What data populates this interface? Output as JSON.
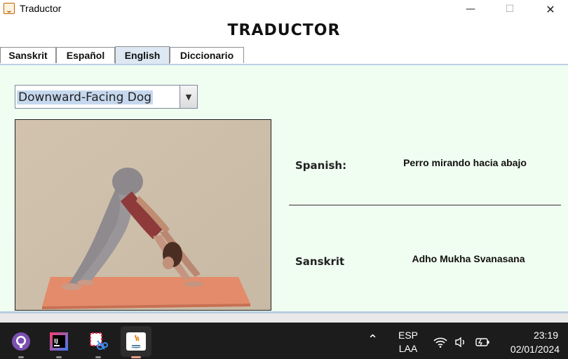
{
  "window": {
    "title": "Traductor",
    "minimize_glyph": "—",
    "maximize_glyph": "☐",
    "close_glyph": "✕"
  },
  "app": {
    "heading": "TRADUCTOR"
  },
  "tabs": [
    {
      "label": "Sanskrit",
      "active": false
    },
    {
      "label": "Español",
      "active": false
    },
    {
      "label": "English",
      "active": true
    },
    {
      "label": "Diccionario",
      "active": false
    }
  ],
  "pose_select": {
    "selected": "Downward-Facing Dog"
  },
  "translations": {
    "spanish_label": "Spanish:",
    "spanish_value": "Perro mirando hacia abajo",
    "sanskrit_label": "Sanskrit",
    "sanskrit_value": "Adho Mukha Svanasana"
  },
  "image": {
    "subject": "downward-facing-dog-pose-photo"
  },
  "taskbar": {
    "apps": [
      "github-desktop-icon",
      "intellij-idea-icon",
      "snipping-tool-icon",
      "java-icon"
    ],
    "active_app": "java-icon",
    "language_line1": "ESP",
    "language_line2": "LAA",
    "time": "23:19",
    "date": "02/01/2024"
  },
  "colors": {
    "panel_bg": "#f0fdf1",
    "active_tab_bg": "#dde8f3",
    "selection_bg": "#c6d8ee",
    "taskbar_bg": "#1c1c1c"
  }
}
